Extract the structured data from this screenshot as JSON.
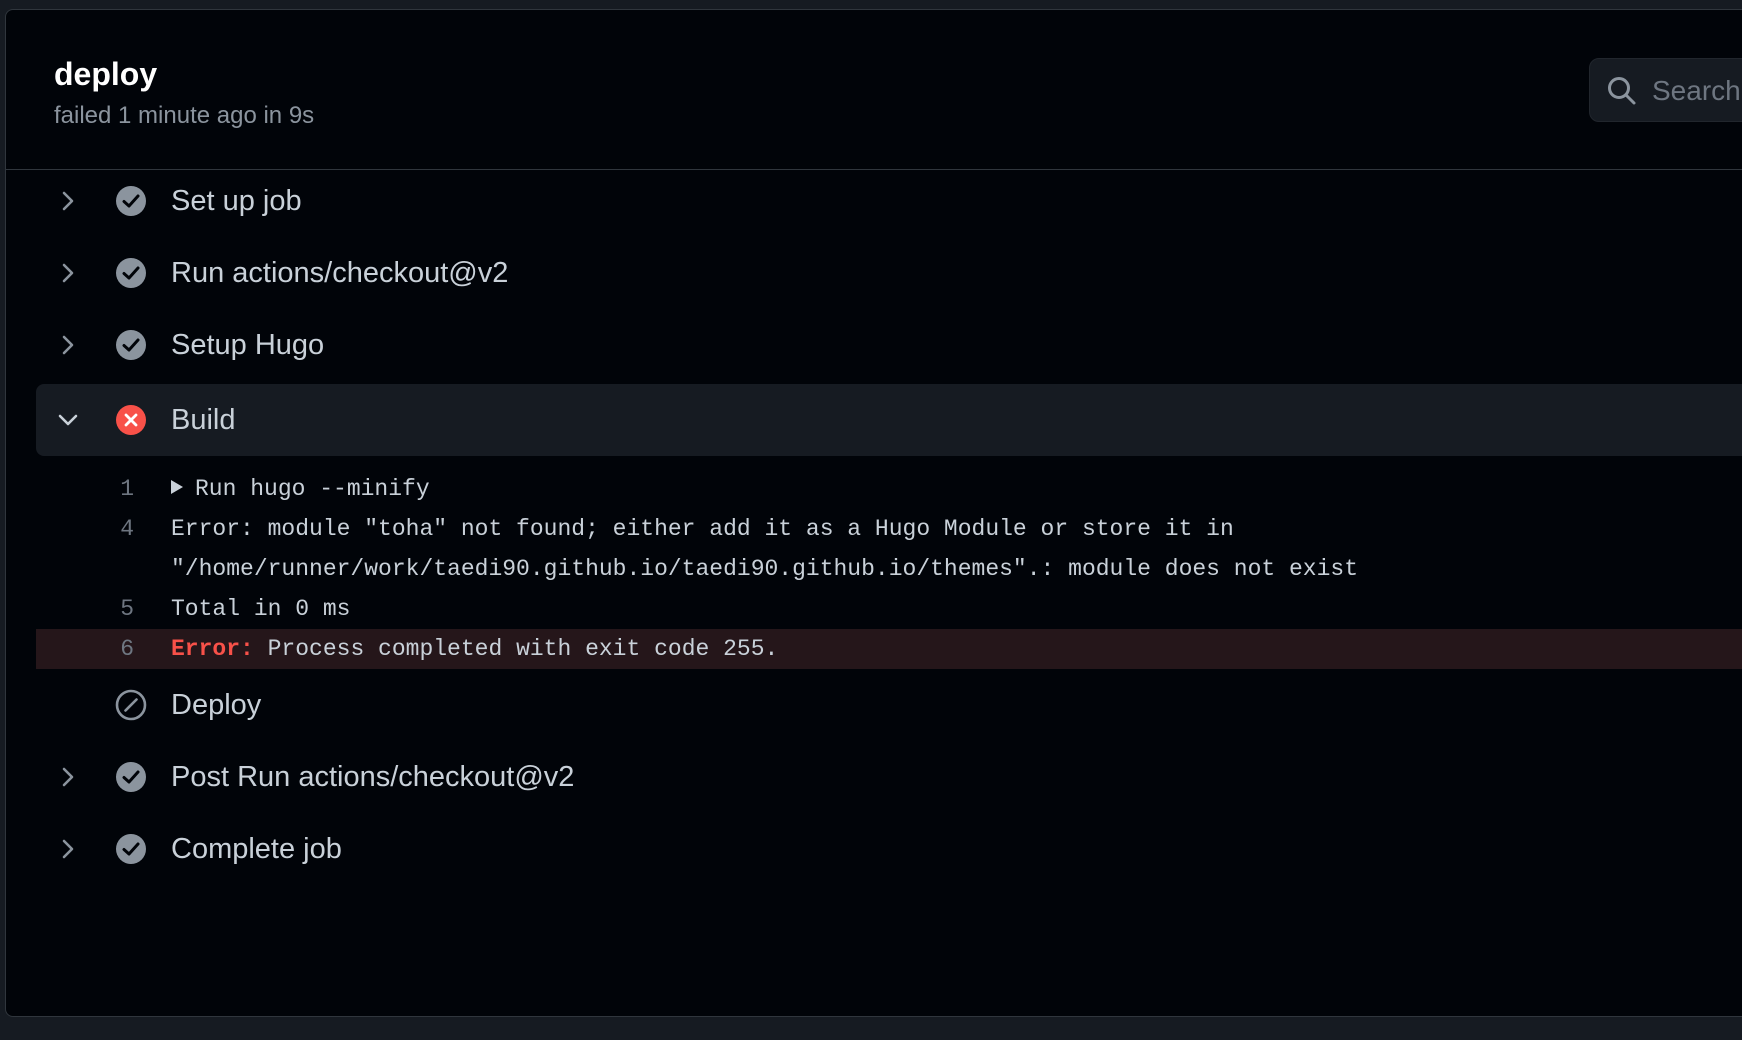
{
  "job": {
    "title": "deploy",
    "subtitle": "failed 1 minute ago in 9s"
  },
  "search": {
    "placeholder": "Search logs"
  },
  "steps": [
    {
      "label": "Set up job",
      "status": "success",
      "icon": "check-circle-icon"
    },
    {
      "label": "Run actions/checkout@v2",
      "status": "success",
      "icon": "check-circle-icon"
    },
    {
      "label": "Setup Hugo",
      "status": "success",
      "icon": "check-circle-icon"
    },
    {
      "label": "Build",
      "status": "failure",
      "icon": "x-circle-icon",
      "expanded": true
    },
    {
      "label": "Deploy",
      "status": "skipped",
      "icon": "skip-icon"
    },
    {
      "label": "Post Run actions/checkout@v2",
      "status": "success",
      "icon": "check-circle-icon"
    },
    {
      "label": "Complete job",
      "status": "success",
      "icon": "check-circle-icon"
    }
  ],
  "build_log": [
    {
      "num": "1",
      "text": "Run hugo --minify",
      "collapsible": true
    },
    {
      "num": "4",
      "text": "Error: module \"toha\" not found; either add it as a Hugo Module or store it in"
    },
    {
      "num": "",
      "text": "\"/home/runner/work/taedi90.github.io/taedi90.github.io/themes\".: module does not exist"
    },
    {
      "num": "5",
      "text": "Total in 0 ms"
    },
    {
      "num": "6",
      "error_label": "Error:",
      "text": " Process completed with exit code 255.",
      "is_error": true
    }
  ],
  "colors": {
    "success_icon": "#8b949e",
    "failure_icon": "#f85149",
    "error_text": "#f85149",
    "error_row_bg": "#25161a",
    "panel_bg": "#010409",
    "expanded_row_bg": "#161b22"
  }
}
